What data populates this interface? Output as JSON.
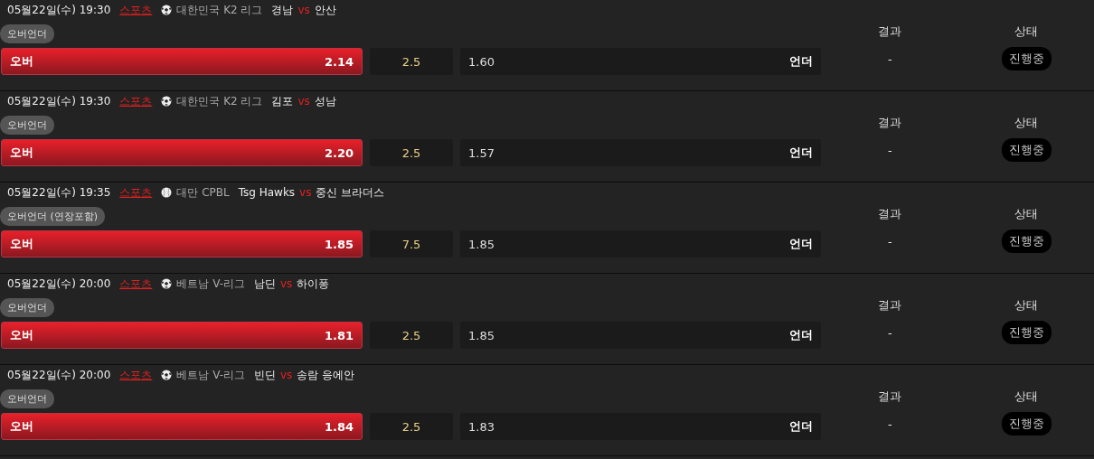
{
  "games": [
    {
      "date": "05월22일(수) 19:30",
      "sport": "스포츠",
      "kind": "soccer",
      "league": "대한민국 K2 리그",
      "home": "경남",
      "vs": "vs",
      "away": "안산",
      "market": "오버언더",
      "over_label": "오버",
      "over_odds": "2.14",
      "line": "2.5",
      "under_odds": "1.60",
      "under_label": "언더",
      "result_header": "결과",
      "result": "-",
      "status_header": "상태",
      "status": "진행중"
    },
    {
      "date": "05월22일(수) 19:30",
      "sport": "스포츠",
      "kind": "soccer",
      "league": "대한민국 K2 리그",
      "home": "김포",
      "vs": "vs",
      "away": "성남",
      "market": "오버언더",
      "over_label": "오버",
      "over_odds": "2.20",
      "line": "2.5",
      "under_odds": "1.57",
      "under_label": "언더",
      "result_header": "결과",
      "result": "-",
      "status_header": "상태",
      "status": "진행중"
    },
    {
      "date": "05월22일(수) 19:35",
      "sport": "스포츠",
      "kind": "baseball",
      "league": "대만 CPBL",
      "home": "Tsg Hawks",
      "vs": "vs",
      "away": "중신 브라더스",
      "market": "오버언더 (연장포함)",
      "over_label": "오버",
      "over_odds": "1.85",
      "line": "7.5",
      "under_odds": "1.85",
      "under_label": "언더",
      "result_header": "결과",
      "result": "-",
      "status_header": "상태",
      "status": "진행중"
    },
    {
      "date": "05월22일(수) 20:00",
      "sport": "스포츠",
      "kind": "soccer",
      "league": "베트남 V-리그",
      "home": "남딘",
      "vs": "vs",
      "away": "하이퐁",
      "market": "오버언더",
      "over_label": "오버",
      "over_odds": "1.81",
      "line": "2.5",
      "under_odds": "1.85",
      "under_label": "언더",
      "result_header": "결과",
      "result": "-",
      "status_header": "상태",
      "status": "진행중"
    },
    {
      "date": "05월22일(수) 20:00",
      "sport": "스포츠",
      "kind": "soccer",
      "league": "베트남 V-리그",
      "home": "빈딘",
      "vs": "vs",
      "away": "송람 응에안",
      "market": "오버언더",
      "over_label": "오버",
      "over_odds": "1.84",
      "line": "2.5",
      "under_odds": "1.83",
      "under_label": "언더",
      "result_header": "결과",
      "result": "-",
      "status_header": "상태",
      "status": "진행중"
    }
  ]
}
